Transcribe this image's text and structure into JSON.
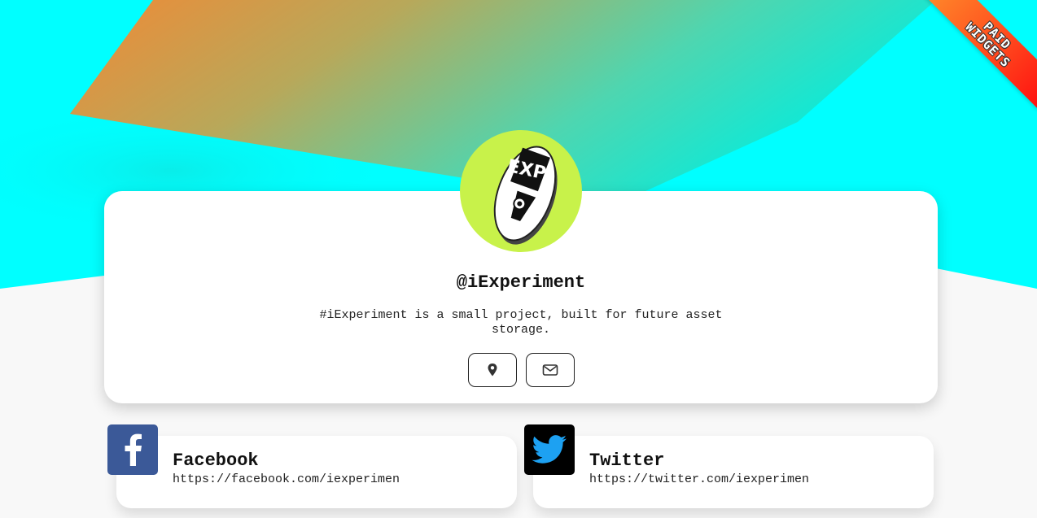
{
  "ribbon": {
    "line1": "PAID",
    "line2": "WIDGETS"
  },
  "profile": {
    "username": "@iExperiment",
    "bio": "#iExperiment is a small project, built for future asset storage.",
    "avatar_icon": "iexp-logo-icon",
    "actions": [
      {
        "icon": "location-pin-icon"
      },
      {
        "icon": "envelope-icon"
      }
    ]
  },
  "links": [
    {
      "title": "Facebook",
      "url": "https://facebook.com/iexperimen",
      "icon": "facebook-icon",
      "color": "#3b5998"
    },
    {
      "title": "Twitter",
      "url": "https://twitter.com/iexperimen",
      "icon": "twitter-icon",
      "color": "#000000"
    }
  ],
  "colors": {
    "background_cyan": "#00ffff",
    "accent_orange": "#ef8a38",
    "avatar_bg": "#c8f24a",
    "page_bg": "#f8f8f8"
  }
}
